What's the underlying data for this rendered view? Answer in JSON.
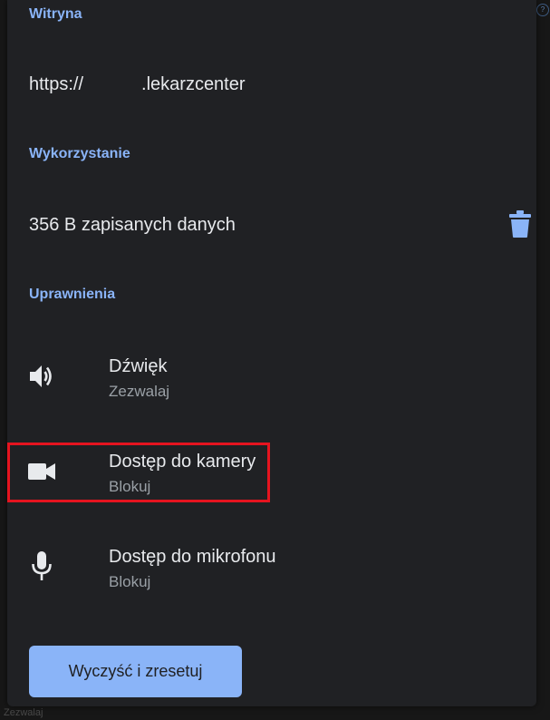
{
  "site": {
    "heading": "Witryna",
    "url_prefix": "https://",
    "url_suffix": ".lekarzcenter"
  },
  "usage": {
    "heading": "Wykorzystanie",
    "text": "356 B zapisanych danych",
    "delete_icon": "trash-icon"
  },
  "permissions": {
    "heading": "Uprawnienia",
    "items": [
      {
        "icon": "speaker-icon",
        "title": "Dźwięk",
        "status": "Zezwalaj"
      },
      {
        "icon": "camera-icon",
        "title": "Dostęp do kamery",
        "status": "Blokuj"
      },
      {
        "icon": "microphone-icon",
        "title": "Dostęp do mikrofonu",
        "status": "Blokuj"
      }
    ]
  },
  "reset_button": {
    "label": "Wyczyść i zresetuj"
  },
  "background": {
    "partial_text": "Zezwalaj"
  },
  "colors": {
    "accent": "#8ab4f8",
    "dialog_bg": "#202124",
    "text_primary": "#e8eaed",
    "text_secondary": "#9aa0a6",
    "highlight": "#e5141f"
  }
}
